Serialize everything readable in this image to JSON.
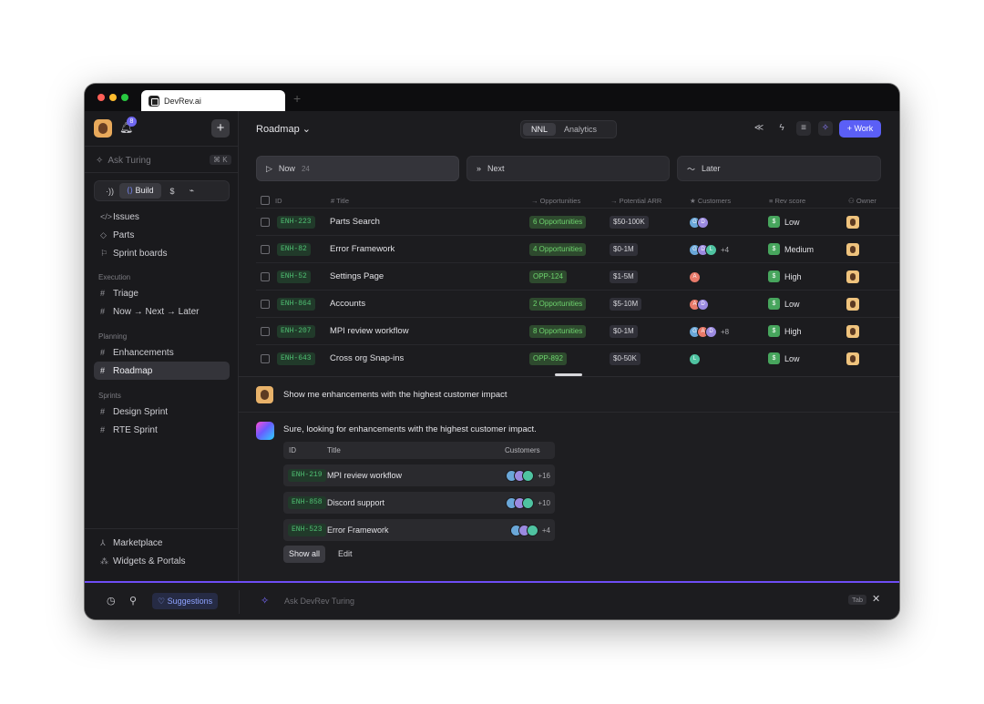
{
  "browser": {
    "tab_title": "DevRev.ai",
    "new_tab": "+"
  },
  "sidebar": {
    "notif_count": "8",
    "plus": "+",
    "ask_label": "Ask Turing",
    "ask_shortcut": "⌘ K",
    "modes": {
      "signal": "·))",
      "build": "Build",
      "dollar": "$",
      "pulse": "⌁"
    },
    "top_items": [
      {
        "icon": "</>",
        "label": "Issues"
      },
      {
        "icon": "◇",
        "label": "Parts"
      },
      {
        "icon": "⚐",
        "label": "Sprint boards"
      }
    ],
    "sections": [
      {
        "title": "Execution",
        "items": [
          "Triage",
          "Now → Next → Later"
        ]
      },
      {
        "title": "Planning",
        "items": [
          "Enhancements",
          "Roadmap"
        ]
      },
      {
        "title": "Sprints",
        "items": [
          "Design Sprint",
          "RTE Sprint"
        ]
      }
    ],
    "bottom_items": [
      {
        "icon": "⅄",
        "label": "Marketplace"
      },
      {
        "icon": "⁂",
        "label": "Widgets & Portals"
      }
    ]
  },
  "header": {
    "breadcrumb": "Roadmap ⌄",
    "toggle": {
      "nnl": "NNL",
      "analytics": "Analytics"
    },
    "icons": {
      "share": "≪",
      "bolt": "ϟ",
      "filter": "≡",
      "sparkle": "✧"
    },
    "work_button": "+ Work"
  },
  "lanes": [
    {
      "icon": "▷",
      "label": "Now",
      "count": "24"
    },
    {
      "icon": "»",
      "label": "Next",
      "count": ""
    },
    {
      "icon": "〜",
      "label": "Later",
      "count": ""
    }
  ],
  "table": {
    "headers": [
      "ID",
      "Title",
      "Opportunities",
      "Potential ARR",
      "Customers",
      "Rev score",
      "Owner"
    ],
    "rows": [
      {
        "id": "ENH-223",
        "title": "Parts Search",
        "opp": "6 Opportunities",
        "arr": "$50-100K",
        "customers": [
          "G",
          "D"
        ],
        "more": "",
        "rev": "Low"
      },
      {
        "id": "ENH-82",
        "title": "Error Framework",
        "opp": "4 Opportunities",
        "arr": "$0-1M",
        "customers": [
          "G",
          "D",
          "L"
        ],
        "more": "+4",
        "rev": "Medium"
      },
      {
        "id": "ENH-52",
        "title": "Settings Page",
        "opp": "OPP-124",
        "arr": "$1-5M",
        "customers": [
          "A"
        ],
        "more": "",
        "rev": "High"
      },
      {
        "id": "ENH-864",
        "title": "Accounts",
        "opp": "2 Opportunities",
        "arr": "$5-10M",
        "customers": [
          "A",
          "D"
        ],
        "more": "",
        "rev": "Low"
      },
      {
        "id": "ENH-207",
        "title": "MPI review workflow",
        "opp": "8 Opportunities",
        "arr": "$0-1M",
        "customers": [
          "G",
          "A",
          "D"
        ],
        "more": "+8",
        "rev": "High"
      },
      {
        "id": "ENH-643",
        "title": "Cross org Snap-ins",
        "opp": "OPP-892",
        "arr": "$0-50K",
        "customers": [
          "L"
        ],
        "more": "",
        "rev": "Low"
      }
    ]
  },
  "chat": {
    "user_message": "Show me enhancements with the highest customer impact",
    "ai_message": "Sure, looking for enhancements with the highest customer impact.",
    "result_headers": {
      "id": "ID",
      "title": "Title",
      "customers": "Customers"
    },
    "results": [
      {
        "id": "ENH-219",
        "title": "MPI review workflow",
        "more": "+16"
      },
      {
        "id": "ENH-858",
        "title": "Discord support",
        "more": "+10"
      },
      {
        "id": "ENH-523",
        "title": "Error Framework",
        "more": "+4"
      }
    ],
    "show_all": "Show all",
    "edit": "Edit"
  },
  "bottombar": {
    "clock": "◷",
    "pin": "⚲",
    "suggestions": "Suggestions",
    "placeholder": "Ask DevRev Turing",
    "tab_key": "Tab",
    "close": "✕"
  },
  "colors": {
    "accent": "#5b5ff6",
    "id_green": "#4fbf72",
    "panel": "#1c1c1f",
    "purple_line": "#6e4df5"
  }
}
